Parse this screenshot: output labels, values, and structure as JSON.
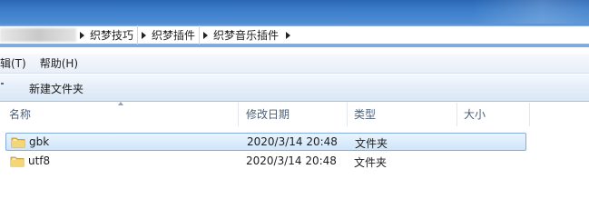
{
  "address": {
    "crumbs": [
      "织梦技巧",
      "织梦插件",
      "织梦音乐插件"
    ]
  },
  "menu": {
    "items": [
      "编辑(T)",
      "帮助(H)"
    ]
  },
  "toolbar": {
    "new_folder": "新建文件夹"
  },
  "columns": {
    "name": "名称",
    "modified": "修改日期",
    "type": "类型",
    "size": "大小"
  },
  "files": [
    {
      "name": "gbk",
      "modified": "2020/3/14 20:48",
      "type": "文件夹",
      "size": "",
      "selected": true
    },
    {
      "name": "utf8",
      "modified": "2020/3/14 20:48",
      "type": "文件夹",
      "size": "",
      "selected": false
    }
  ],
  "colors": {
    "title_blue": "#2a66b4",
    "selection_border": "#84acdd",
    "folder_yellow": "#e8c14e"
  }
}
